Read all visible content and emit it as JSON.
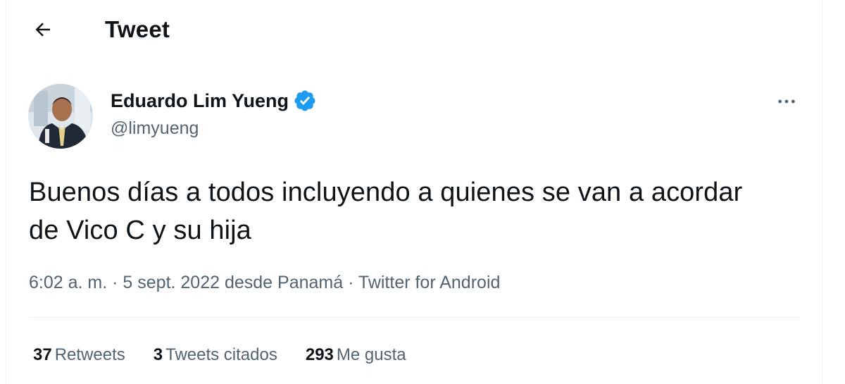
{
  "header": {
    "title": "Tweet",
    "back_icon": "arrow-left-icon"
  },
  "author": {
    "name": "Eduardo Lim Yueng",
    "handle": "@limyueng",
    "verified": true,
    "verified_color": "#1d9bf0",
    "avatar_icon": "user-avatar"
  },
  "more_icon": "more-horizontal-icon",
  "tweet": {
    "text": "Buenos días a todos incluyendo a quienes se van a acordar de Vico C y su hija",
    "time": "6:02 a. m.",
    "separator": "·",
    "date_location": "5 sept. 2022 desde Panamá",
    "source": "Twitter for Android"
  },
  "stats": [
    {
      "count": "37",
      "label": "Retweets"
    },
    {
      "count": "3",
      "label": "Tweets citados"
    },
    {
      "count": "293",
      "label": "Me gusta"
    }
  ],
  "colors": {
    "text": "#0f1419",
    "secondary": "#536471",
    "divider": "#eff3f4"
  }
}
